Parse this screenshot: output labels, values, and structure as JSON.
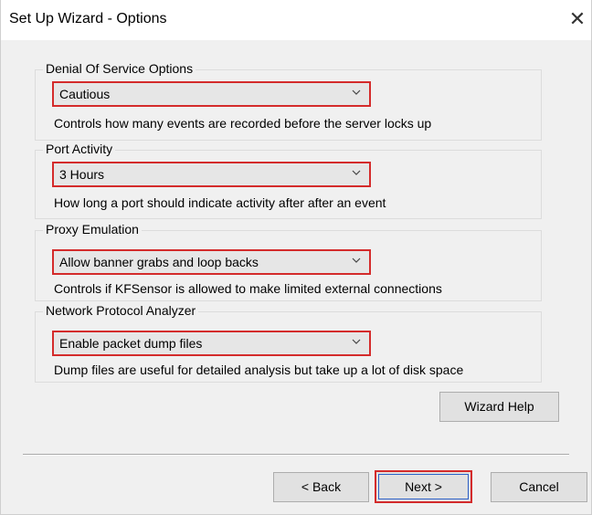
{
  "window": {
    "title": "Set Up Wizard - Options",
    "close_glyph": "✕"
  },
  "groups": [
    {
      "legend": "Denial Of Service Options",
      "selected": "Cautious",
      "description": "Controls how many events are recorded before the server locks up"
    },
    {
      "legend": "Port Activity",
      "selected": "3 Hours",
      "description": "How long a port should indicate activity after after an event"
    },
    {
      "legend": "Proxy Emulation",
      "selected": "Allow banner grabs and loop backs",
      "description": "Controls if KFSensor is allowed to make limited external connections"
    },
    {
      "legend": "Network Protocol Analyzer",
      "selected": "Enable packet dump files",
      "description": "Dump files are useful for detailed analysis but take up a lot of disk space"
    }
  ],
  "buttons": {
    "help": "Wizard Help",
    "back": "< Back",
    "next": "Next >",
    "cancel": "Cancel"
  },
  "colors": {
    "highlight": "#d42b2b",
    "dialog_bg": "#f0f0f0",
    "focus": "#2a62c9"
  },
  "icons": {
    "dropdown": "chevron-down-icon",
    "close": "close-icon"
  }
}
